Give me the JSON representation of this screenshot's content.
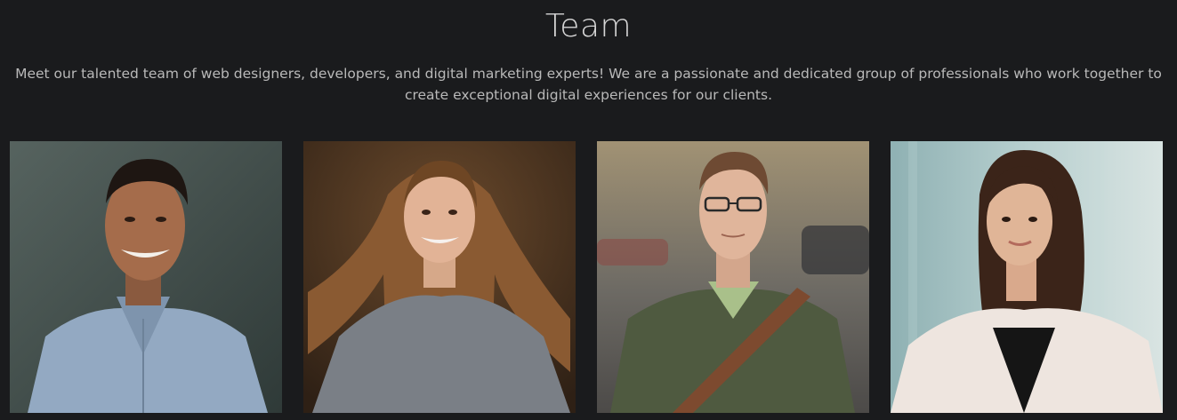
{
  "team": {
    "title": "Team",
    "intro": "Meet our talented team of web designers, developers, and digital marketing experts! We are a passionate and dedicated group of professionals who work together to create exceptional digital experiences for our clients."
  },
  "members": [
    {
      "photo": "portrait-man-smiling-blue-shirt"
    },
    {
      "photo": "portrait-woman-long-hair-gray-sweater"
    },
    {
      "photo": "portrait-man-glasses-green-sweater"
    },
    {
      "photo": "portrait-woman-white-cardigan"
    }
  ],
  "colors": {
    "background": "#1a1b1d",
    "title": "#d6d6d6",
    "text": "#b9b9b9"
  }
}
